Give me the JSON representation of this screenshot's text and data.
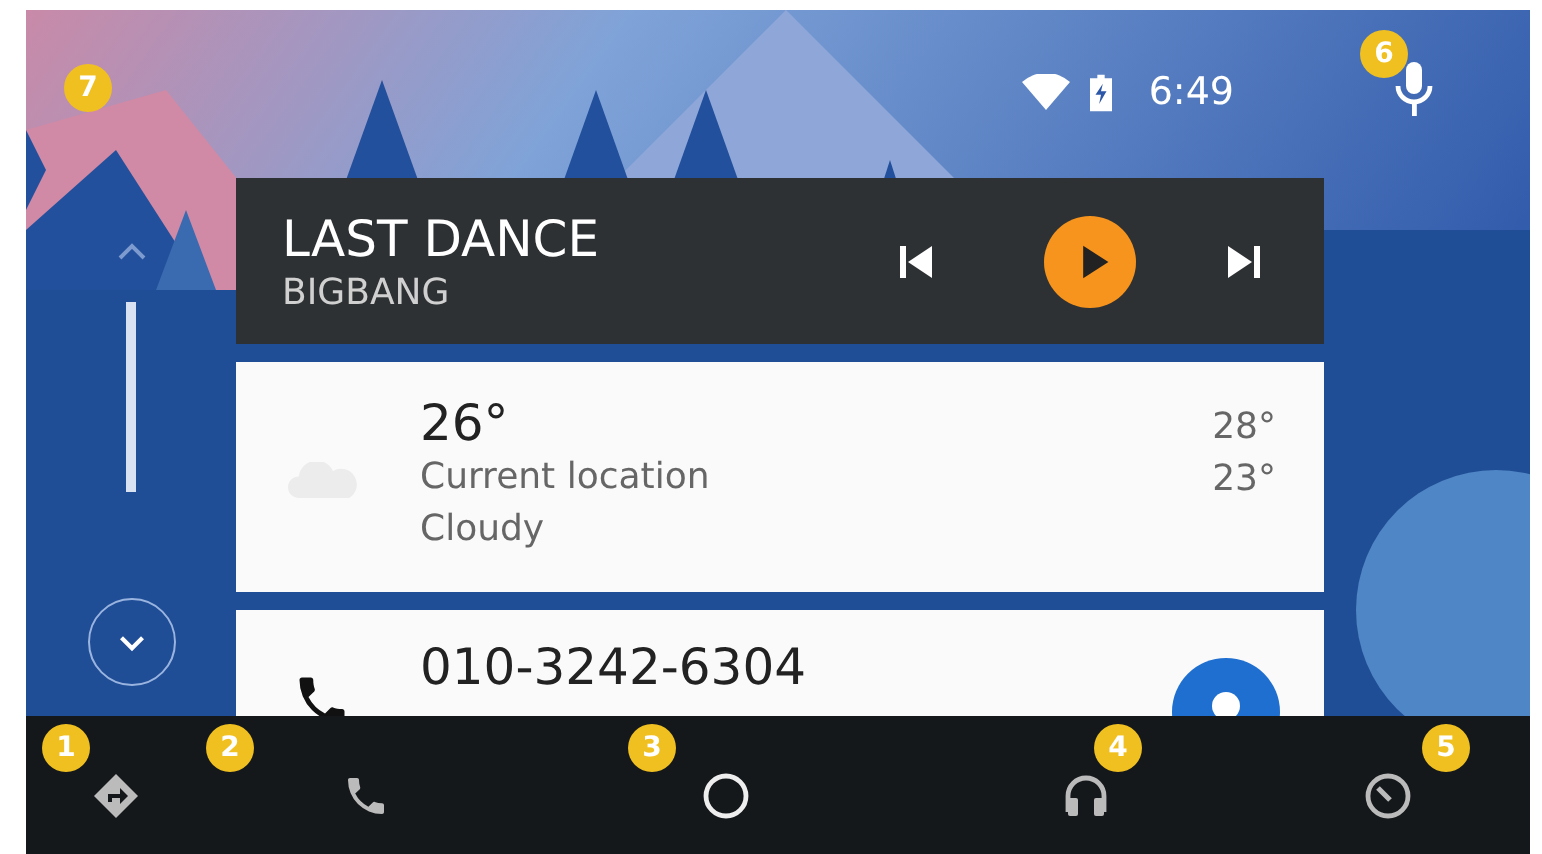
{
  "status_bar": {
    "callout": "7",
    "time": "6:49",
    "voice": {
      "callout": "6"
    }
  },
  "media": {
    "title": "LAST DANCE",
    "artist": "BIGBANG",
    "playing": false
  },
  "weather": {
    "temperature": "26°",
    "location": "Current location",
    "condition": "Cloudy",
    "high": "28°",
    "low": "23°"
  },
  "call": {
    "number": "010-3242-6304"
  },
  "nav": [
    {
      "kind": "navigation",
      "callout": "1"
    },
    {
      "kind": "phone",
      "callout": "2"
    },
    {
      "kind": "home",
      "callout": "3"
    },
    {
      "kind": "audio",
      "callout": "4"
    },
    {
      "kind": "exit",
      "callout": "5"
    }
  ]
}
